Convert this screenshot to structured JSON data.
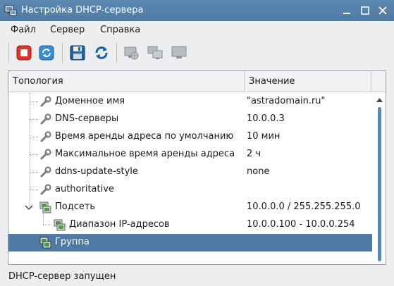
{
  "window": {
    "title": "Настройка DHCP-сервера"
  },
  "menu": {
    "file": "Файл",
    "server": "Сервер",
    "help": "Справка"
  },
  "toolbar": {
    "buttons": [
      {
        "icon": "stop-icon"
      },
      {
        "icon": "refresh-icon"
      },
      {
        "icon": "save-icon"
      },
      {
        "icon": "reload-icon"
      },
      {
        "icon": "network-icon"
      },
      {
        "icon": "hosts-icon"
      },
      {
        "icon": "host-icon"
      }
    ]
  },
  "tree": {
    "columns": {
      "topology": "Топология",
      "value": "Значение"
    },
    "rows": [
      {
        "label": "Доменное имя",
        "value": "\"astradomain.ru\"",
        "icon": "wrench-icon"
      },
      {
        "label": "DNS-серверы",
        "value": "10.0.0.3",
        "icon": "wrench-icon"
      },
      {
        "label": "Время аренды адреса по умолчанию",
        "value": "10 мин",
        "icon": "wrench-icon"
      },
      {
        "label": "Максимальное время аренды адреса",
        "value": "2 ч",
        "icon": "wrench-icon"
      },
      {
        "label": "ddns-update-style",
        "value": "none",
        "icon": "wrench-icon"
      },
      {
        "label": "authoritative",
        "value": "",
        "icon": "wrench-icon"
      },
      {
        "label": "Подсеть",
        "value": "10.0.0.0 / 255.255.255.0",
        "icon": "subnet-icon"
      },
      {
        "label": "Диапазон IP-адресов",
        "value": "10.0.0.100 - 10.0.0.254",
        "icon": "subnet-icon"
      },
      {
        "label": "Группа",
        "value": "",
        "icon": "group-icon"
      }
    ]
  },
  "status": {
    "text": "DHCP-сервер запущен"
  },
  "colors": {
    "titlebar": "#4f7aa3",
    "selection": "#4f7aa3",
    "accent": "#5b89b2"
  }
}
